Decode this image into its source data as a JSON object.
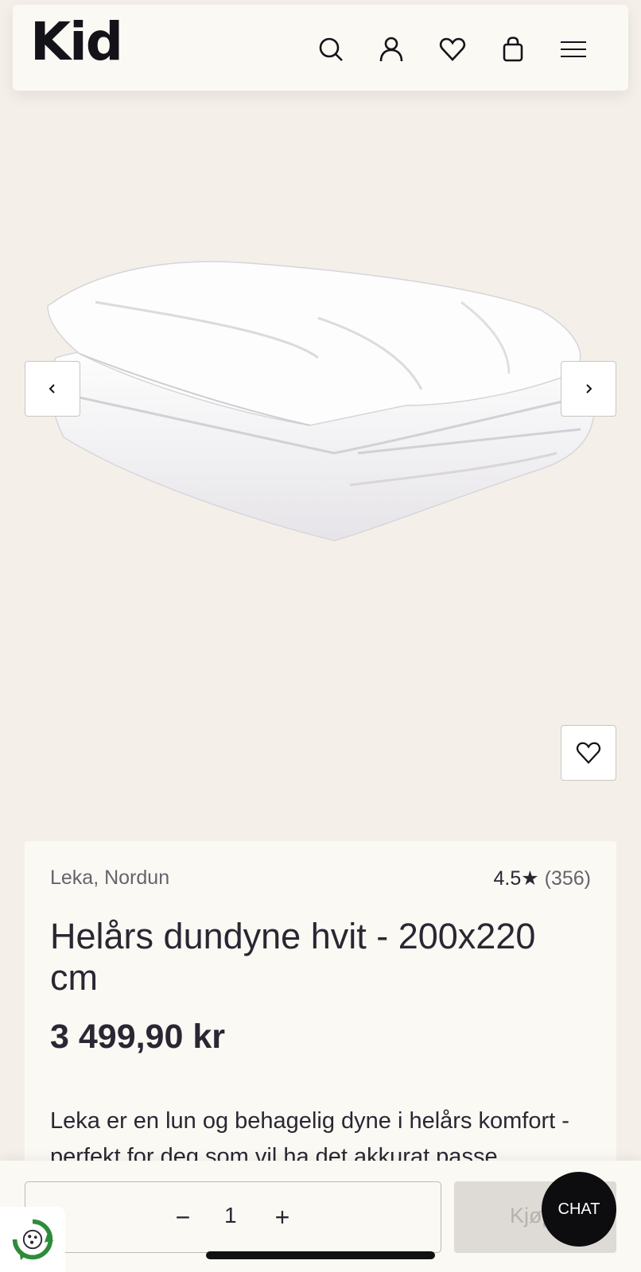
{
  "header": {
    "logo": "Kid",
    "icons": [
      "search-icon",
      "account-icon",
      "wishlist-icon",
      "cart-icon",
      "menu-icon"
    ]
  },
  "gallery": {
    "prev_icon": "chevron-left-icon",
    "next_icon": "chevron-right-icon",
    "favorite_icon": "heart-icon"
  },
  "product": {
    "brand": "Leka, Nordun",
    "rating": "4.5",
    "rating_star": "★",
    "review_count": "(356)",
    "title": "Helårs dundyne hvit - 200x220 cm",
    "price": "3 499,90 kr",
    "description": "Leka er en lun og behagelig dyne i helårs komfort - perfekt for deg som vil ha det akkurat passe"
  },
  "purchase_bar": {
    "quantity": "1",
    "minus": "−",
    "plus": "+",
    "buy_label": "Kjøp",
    "chat_label": "CHAT"
  },
  "colors": {
    "page_bg": "#f4f0e9",
    "card_bg": "#fbf9f4",
    "text": "#2a2733",
    "chat_bg": "#0d0c0e",
    "buy_disabled": "#dedbd7",
    "eco_green": "#2e8b3a"
  }
}
